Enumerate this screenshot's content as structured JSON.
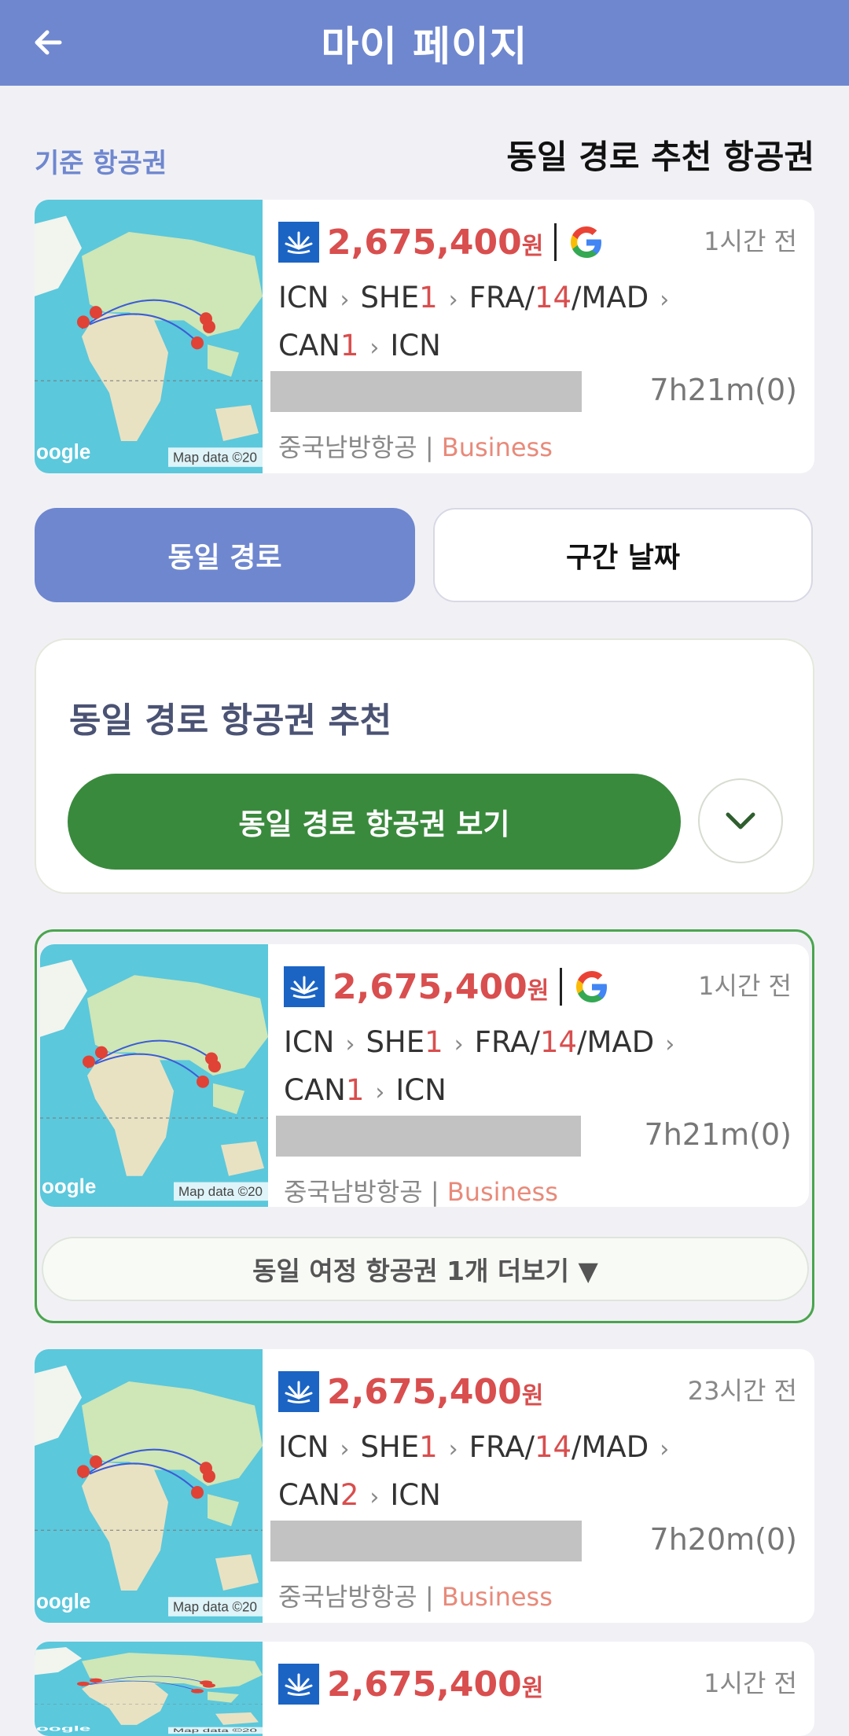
{
  "header": {
    "title": "마이 페이지",
    "back_icon": "back-arrow-icon"
  },
  "labels": {
    "base_ticket": "기준 항공권",
    "recommended": "동일 경로 추천 항공권"
  },
  "colors": {
    "header": "#6f87cf",
    "price": "#d94e4e",
    "green": "#3a8a3d",
    "class": "#e88a7a"
  },
  "base_card": {
    "price": "2,675,400",
    "won": "원",
    "time_ago": "1시간 전",
    "route_line1": {
      "a": "ICN",
      "b": "SHE",
      "b_n": "1",
      "c": "FRA/",
      "c_n": "14",
      "d": "/MAD"
    },
    "route_line2": {
      "a": "CAN",
      "a_n": "1",
      "b": "ICN"
    },
    "duration": "7h21m(0)",
    "carrier": "중국남방항공",
    "cabin": "Business",
    "map_google": "oogle",
    "map_data": "Map data ©20"
  },
  "tabs": {
    "same_route": "동일 경로",
    "section_date": "구간 날짜"
  },
  "reco": {
    "heading": "동일 경로 항공권 추천",
    "button": "동일 경로 항공권 보기"
  },
  "cards": [
    {
      "price": "2,675,400",
      "won": "원",
      "time_ago": "1시간 전",
      "route_line1": {
        "a": "ICN",
        "b": "SHE",
        "b_n": "1",
        "c": "FRA/",
        "c_n": "14",
        "d": "/MAD"
      },
      "route_line2": {
        "a": "CAN",
        "a_n": "1",
        "b": "ICN"
      },
      "duration": "7h21m(0)",
      "carrier": "중국남방항공",
      "cabin": "Business",
      "more": "동일 여정 항공권 1개 더보기 ▼"
    },
    {
      "price": "2,675,400",
      "won": "원",
      "time_ago": "23시간 전",
      "route_line1": {
        "a": "ICN",
        "b": "SHE",
        "b_n": "1",
        "c": "FRA/",
        "c_n": "14",
        "d": "/MAD"
      },
      "route_line2": {
        "a": "CAN",
        "a_n": "2",
        "b": "ICN"
      },
      "duration": "7h20m(0)",
      "carrier": "중국남방항공",
      "cabin": "Business"
    },
    {
      "price": "2,675,400",
      "won": "원",
      "time_ago": "1시간 전"
    }
  ]
}
